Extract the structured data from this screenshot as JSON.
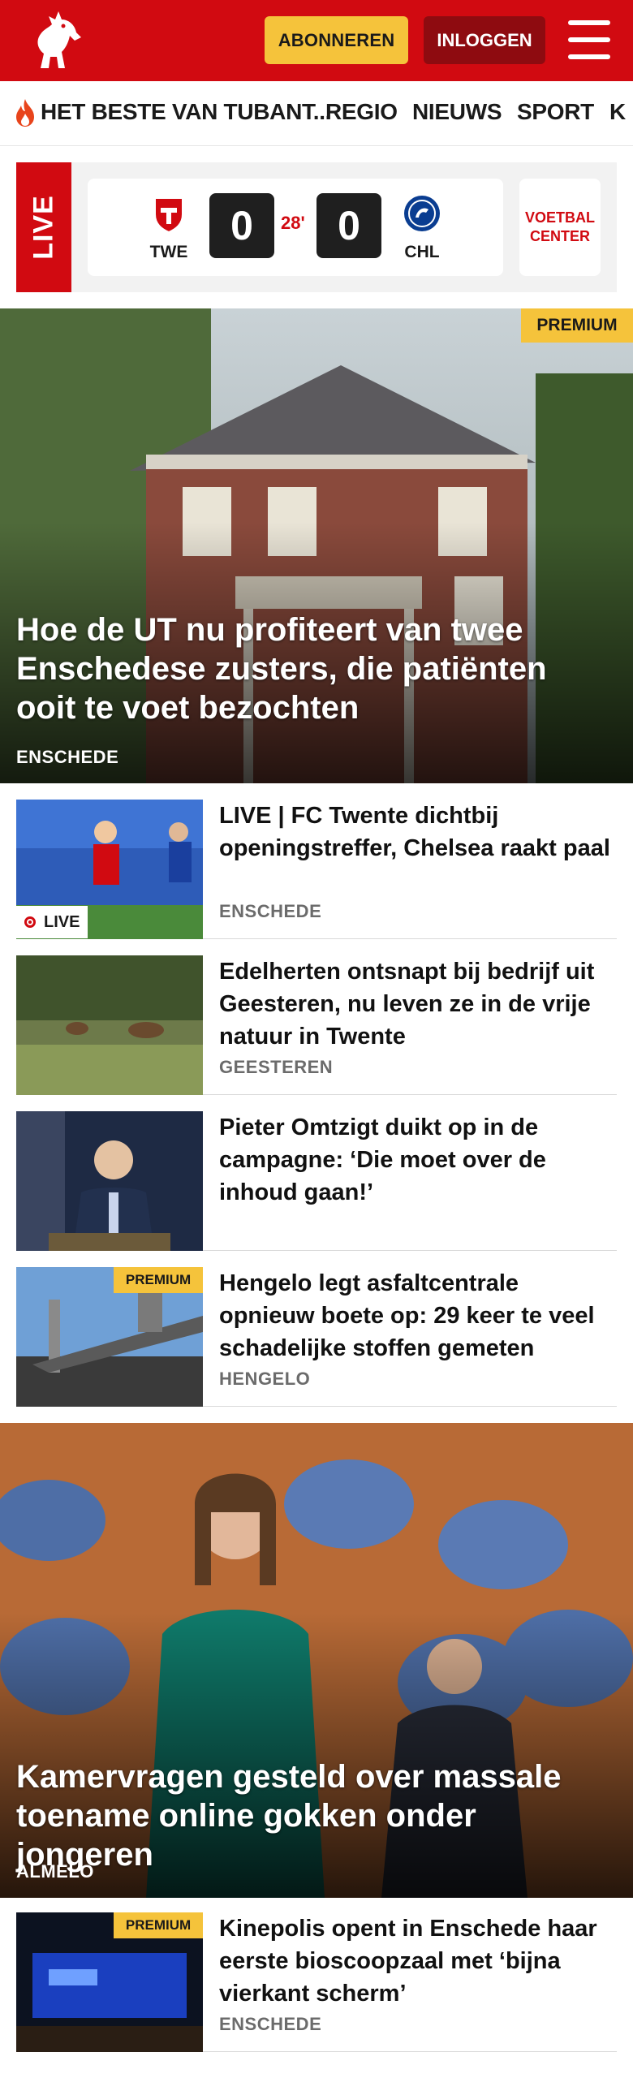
{
  "header": {
    "subscribe_label": "ABONNEREN",
    "login_label": "INLOGGEN",
    "logo_icon": "tubantia-horse-logo",
    "menu_icon": "hamburger-menu-icon",
    "brand_color": "#d10a11",
    "accent_color": "#f5c33b"
  },
  "nav": {
    "items": [
      {
        "label": "HET BESTE VAN TUBANT..."
      },
      {
        "label": "REGIO"
      },
      {
        "label": "NIEUWS"
      },
      {
        "label": "SPORT"
      },
      {
        "label": "K"
      }
    ]
  },
  "live_score": {
    "live_label": "LIVE",
    "home_code": "TWE",
    "away_code": "CHL",
    "home_score": "0",
    "away_score": "0",
    "minute": "28'",
    "voetbal_center_label": "VOETBAL CENTER"
  },
  "hero": {
    "badge": "PREMIUM",
    "title": "Hoe de UT nu profiteert van twee Enschedese zusters, die patiënten ooit te voet bezochten",
    "location": "ENSCHEDE"
  },
  "articles": [
    {
      "title": "LIVE | FC Twente dichtbij openingstreffer, Chelsea raakt paal",
      "location": "ENSCHEDE",
      "badge": "LIVE"
    },
    {
      "title": "Edelherten ontsnapt bij bedrijf uit Geesteren, nu leven ze in de vrije natuur in Twente",
      "location": "GEESTEREN"
    },
    {
      "title": "Pieter Omtzigt duikt op in de campagne: ‘Die moet over de inhoud gaan!’",
      "location": ""
    },
    {
      "title": "Hengelo legt asfaltcentrale opnieuw boete op: 29 keer te veel schadelijke stoffen gemeten",
      "location": "HENGELO",
      "badge": "PREMIUM"
    }
  ],
  "hero2": {
    "title": "Kamervragen gesteld over massale toename online gokken onder jongeren",
    "location": "ALMELO"
  },
  "articles2": [
    {
      "title": "Kinepolis opent in Enschede haar eerste bioscoopzaal met ‘bijna vierkant scherm’",
      "location": "ENSCHEDE",
      "badge": "PREMIUM"
    }
  ]
}
